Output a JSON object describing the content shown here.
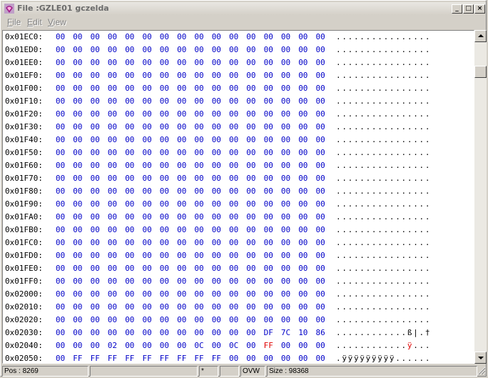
{
  "window": {
    "title": "File :GZLE01 gczelda",
    "controls": {
      "minimize": "_",
      "maximize": "□",
      "close": "×"
    }
  },
  "menu": {
    "items": [
      {
        "accel": "F",
        "rest": "ile"
      },
      {
        "accel": "E",
        "rest": "dit"
      },
      {
        "accel": "V",
        "rest": "iew"
      }
    ]
  },
  "hexview": {
    "rows": [
      {
        "addr": "0x01EC0:",
        "bytes": [
          "00",
          "00",
          "00",
          "00",
          "00",
          "00",
          "00",
          "00",
          "00",
          "00",
          "00",
          "00",
          "00",
          "00",
          "00",
          "00"
        ],
        "ascii": "................"
      },
      {
        "addr": "0x01ED0:",
        "bytes": [
          "00",
          "00",
          "00",
          "00",
          "00",
          "00",
          "00",
          "00",
          "00",
          "00",
          "00",
          "00",
          "00",
          "00",
          "00",
          "00"
        ],
        "ascii": "................"
      },
      {
        "addr": "0x01EE0:",
        "bytes": [
          "00",
          "00",
          "00",
          "00",
          "00",
          "00",
          "00",
          "00",
          "00",
          "00",
          "00",
          "00",
          "00",
          "00",
          "00",
          "00"
        ],
        "ascii": "................"
      },
      {
        "addr": "0x01EF0:",
        "bytes": [
          "00",
          "00",
          "00",
          "00",
          "00",
          "00",
          "00",
          "00",
          "00",
          "00",
          "00",
          "00",
          "00",
          "00",
          "00",
          "00"
        ],
        "ascii": "................"
      },
      {
        "addr": "0x01F00:",
        "bytes": [
          "00",
          "00",
          "00",
          "00",
          "00",
          "00",
          "00",
          "00",
          "00",
          "00",
          "00",
          "00",
          "00",
          "00",
          "00",
          "00"
        ],
        "ascii": "................"
      },
      {
        "addr": "0x01F10:",
        "bytes": [
          "00",
          "00",
          "00",
          "00",
          "00",
          "00",
          "00",
          "00",
          "00",
          "00",
          "00",
          "00",
          "00",
          "00",
          "00",
          "00"
        ],
        "ascii": "................"
      },
      {
        "addr": "0x01F20:",
        "bytes": [
          "00",
          "00",
          "00",
          "00",
          "00",
          "00",
          "00",
          "00",
          "00",
          "00",
          "00",
          "00",
          "00",
          "00",
          "00",
          "00"
        ],
        "ascii": "................"
      },
      {
        "addr": "0x01F30:",
        "bytes": [
          "00",
          "00",
          "00",
          "00",
          "00",
          "00",
          "00",
          "00",
          "00",
          "00",
          "00",
          "00",
          "00",
          "00",
          "00",
          "00"
        ],
        "ascii": "................"
      },
      {
        "addr": "0x01F40:",
        "bytes": [
          "00",
          "00",
          "00",
          "00",
          "00",
          "00",
          "00",
          "00",
          "00",
          "00",
          "00",
          "00",
          "00",
          "00",
          "00",
          "00"
        ],
        "ascii": "................"
      },
      {
        "addr": "0x01F50:",
        "bytes": [
          "00",
          "00",
          "00",
          "00",
          "00",
          "00",
          "00",
          "00",
          "00",
          "00",
          "00",
          "00",
          "00",
          "00",
          "00",
          "00"
        ],
        "ascii": "................"
      },
      {
        "addr": "0x01F60:",
        "bytes": [
          "00",
          "00",
          "00",
          "00",
          "00",
          "00",
          "00",
          "00",
          "00",
          "00",
          "00",
          "00",
          "00",
          "00",
          "00",
          "00"
        ],
        "ascii": "................"
      },
      {
        "addr": "0x01F70:",
        "bytes": [
          "00",
          "00",
          "00",
          "00",
          "00",
          "00",
          "00",
          "00",
          "00",
          "00",
          "00",
          "00",
          "00",
          "00",
          "00",
          "00"
        ],
        "ascii": "................"
      },
      {
        "addr": "0x01F80:",
        "bytes": [
          "00",
          "00",
          "00",
          "00",
          "00",
          "00",
          "00",
          "00",
          "00",
          "00",
          "00",
          "00",
          "00",
          "00",
          "00",
          "00"
        ],
        "ascii": "................"
      },
      {
        "addr": "0x01F90:",
        "bytes": [
          "00",
          "00",
          "00",
          "00",
          "00",
          "00",
          "00",
          "00",
          "00",
          "00",
          "00",
          "00",
          "00",
          "00",
          "00",
          "00"
        ],
        "ascii": "................"
      },
      {
        "addr": "0x01FA0:",
        "bytes": [
          "00",
          "00",
          "00",
          "00",
          "00",
          "00",
          "00",
          "00",
          "00",
          "00",
          "00",
          "00",
          "00",
          "00",
          "00",
          "00"
        ],
        "ascii": "................"
      },
      {
        "addr": "0x01FB0:",
        "bytes": [
          "00",
          "00",
          "00",
          "00",
          "00",
          "00",
          "00",
          "00",
          "00",
          "00",
          "00",
          "00",
          "00",
          "00",
          "00",
          "00"
        ],
        "ascii": "................"
      },
      {
        "addr": "0x01FC0:",
        "bytes": [
          "00",
          "00",
          "00",
          "00",
          "00",
          "00",
          "00",
          "00",
          "00",
          "00",
          "00",
          "00",
          "00",
          "00",
          "00",
          "00"
        ],
        "ascii": "................"
      },
      {
        "addr": "0x01FD0:",
        "bytes": [
          "00",
          "00",
          "00",
          "00",
          "00",
          "00",
          "00",
          "00",
          "00",
          "00",
          "00",
          "00",
          "00",
          "00",
          "00",
          "00"
        ],
        "ascii": "................"
      },
      {
        "addr": "0x01FE0:",
        "bytes": [
          "00",
          "00",
          "00",
          "00",
          "00",
          "00",
          "00",
          "00",
          "00",
          "00",
          "00",
          "00",
          "00",
          "00",
          "00",
          "00"
        ],
        "ascii": "................"
      },
      {
        "addr": "0x01FF0:",
        "bytes": [
          "00",
          "00",
          "00",
          "00",
          "00",
          "00",
          "00",
          "00",
          "00",
          "00",
          "00",
          "00",
          "00",
          "00",
          "00",
          "00"
        ],
        "ascii": "................"
      },
      {
        "addr": "0x02000:",
        "bytes": [
          "00",
          "00",
          "00",
          "00",
          "00",
          "00",
          "00",
          "00",
          "00",
          "00",
          "00",
          "00",
          "00",
          "00",
          "00",
          "00"
        ],
        "ascii": "................"
      },
      {
        "addr": "0x02010:",
        "bytes": [
          "00",
          "00",
          "00",
          "00",
          "00",
          "00",
          "00",
          "00",
          "00",
          "00",
          "00",
          "00",
          "00",
          "00",
          "00",
          "00"
        ],
        "ascii": "................"
      },
      {
        "addr": "0x02020:",
        "bytes": [
          "00",
          "00",
          "00",
          "00",
          "00",
          "00",
          "00",
          "00",
          "00",
          "00",
          "00",
          "00",
          "00",
          "00",
          "00",
          "00"
        ],
        "ascii": "................"
      },
      {
        "addr": "0x02030:",
        "bytes": [
          "00",
          "00",
          "00",
          "00",
          "00",
          "00",
          "00",
          "00",
          "00",
          "00",
          "00",
          "00",
          "DF",
          "7C",
          "10",
          "86"
        ],
        "ascii": "............ß|.†"
      },
      {
        "addr": "0x02040:",
        "bytes": [
          "00",
          "00",
          "00",
          "02",
          "00",
          "00",
          "00",
          "00",
          "0C",
          "00",
          "0C",
          "00",
          "FF",
          "00",
          "00",
          "00"
        ],
        "ascii": "............ÿ..."
      },
      {
        "addr": "0x02050:",
        "bytes": [
          "00",
          "FF",
          "FF",
          "FF",
          "FF",
          "FF",
          "FF",
          "FF",
          "FF",
          "FF",
          "00",
          "00",
          "00",
          "00",
          "00",
          "00"
        ],
        "ascii": ".ÿÿÿÿÿÿÿÿÿ......"
      }
    ],
    "cursor_row": 24,
    "cursor_col": 12,
    "byte_color": "#0000c8",
    "cursor_color": "#e00000"
  },
  "status": {
    "pos": "Pos : 8269",
    "modified": "*",
    "mode": "OVW",
    "size": "Size : 98368"
  }
}
